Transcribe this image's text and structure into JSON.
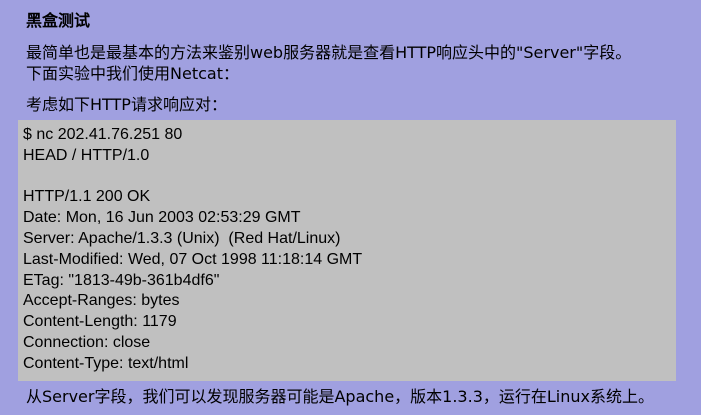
{
  "heading": "黑盒测试",
  "intro": {
    "line1": "最简单也是最基本的方法来鉴别web服务器就是查看HTTP响应头中的\"Server\"字段。",
    "line2": "下面实验中我们使用Netcat："
  },
  "lead": "考虑如下HTTP请求响应对：",
  "code_lines": [
    "$ nc 202.41.76.251 80",
    "HEAD / HTTP/1.0",
    "",
    "HTTP/1.1 200 OK",
    "Date: Mon, 16 Jun 2003 02:53:29 GMT",
    "Server: Apache/1.3.3 (Unix)  (Red Hat/Linux)",
    "Last-Modified: Wed, 07 Oct 1998 11:18:14 GMT",
    "ETag: \"1813-49b-361b4df6\"",
    "Accept-Ranges: bytes",
    "Content-Length: 1179",
    "Connection: close",
    "Content-Type: text/html"
  ],
  "footer": "从Server字段，我们可以发现服务器可能是Apache，版本1.3.3，运行在Linux系统上。",
  "colors": {
    "background": "#a0a0e0",
    "code_background": "#c0c0c0"
  }
}
